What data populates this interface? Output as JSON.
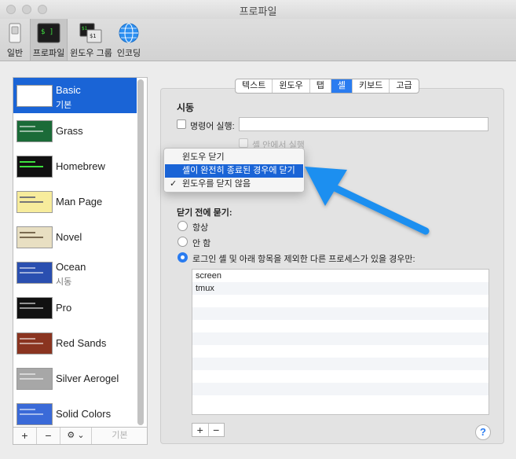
{
  "window": {
    "title": "프로파일"
  },
  "toolbar": {
    "items": [
      {
        "label": "일반",
        "icon": "switch-icon"
      },
      {
        "label": "프로파일",
        "icon": "terminal-icon"
      },
      {
        "label": "윈도우 그룹",
        "icon": "window-group-icon"
      },
      {
        "label": "인코딩",
        "icon": "globe-icon"
      }
    ],
    "selected": "프로파일"
  },
  "profiles": {
    "items": [
      {
        "name": "Basic",
        "sub": "기본",
        "thumb_color": "#ffffff",
        "selected": true
      },
      {
        "name": "Grass",
        "sub": "",
        "thumb_color": "#1b6b38"
      },
      {
        "name": "Homebrew",
        "sub": "",
        "thumb_color": "#111111"
      },
      {
        "name": "Man Page",
        "sub": "",
        "thumb_color": "#f7ec9c"
      },
      {
        "name": "Novel",
        "sub": "",
        "thumb_color": "#e8dfc2"
      },
      {
        "name": "Ocean",
        "sub": "시동",
        "thumb_color": "#2a4fb0"
      },
      {
        "name": "Pro",
        "sub": "",
        "thumb_color": "#111111"
      },
      {
        "name": "Red Sands",
        "sub": "",
        "thumb_color": "#8a3420"
      },
      {
        "name": "Silver Aerogel",
        "sub": "",
        "thumb_color": "#a7a7a7"
      },
      {
        "name": "Solid Colors",
        "sub": "",
        "thumb_color": "#3a6ad8"
      }
    ],
    "bottom": {
      "add": "+",
      "remove": "−",
      "gear": "⚙ ⌄",
      "default": "기본"
    }
  },
  "tabs": [
    {
      "label": "텍스트"
    },
    {
      "label": "윈도우"
    },
    {
      "label": "탭"
    },
    {
      "label": "셸",
      "active": true
    },
    {
      "label": "키보드"
    },
    {
      "label": "고급"
    }
  ],
  "shell": {
    "startup_title": "시동",
    "run_command_label": "명령어 실행:",
    "run_in_shell_label": "셸 안에서 실행",
    "close_menu": {
      "items": [
        {
          "label": "윈도우 닫기"
        },
        {
          "label": "셸이 완전히 종료된 경우에 닫기",
          "highlighted": true
        },
        {
          "label": "윈도우를 닫지 않음",
          "checked": true
        }
      ],
      "check": "✓"
    },
    "ask_before_close_title": "닫기 전에 묻기:",
    "ask_options": [
      {
        "label": "항상"
      },
      {
        "label": "안 함"
      },
      {
        "label": "로그인 셸 및 아래 항목을 제외한 다른 프로세스가 있을 경우만:",
        "selected": true
      }
    ],
    "processes": [
      "screen",
      "tmux"
    ],
    "list_add": "+",
    "list_remove": "−",
    "help": "?"
  },
  "colors": {
    "accent": "#1a64d6",
    "arrow": "#1f8ff0"
  }
}
